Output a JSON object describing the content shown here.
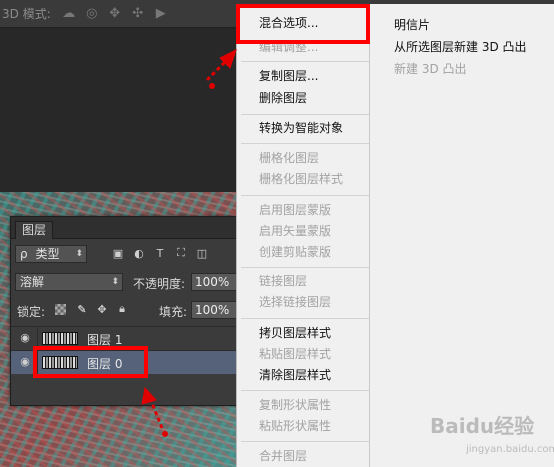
{
  "options_bar": {
    "mode_label": "3D 模式:",
    "icons": [
      "orbit-icon",
      "roll-icon",
      "pan-icon",
      "slide-icon",
      "camera-zoom-icon"
    ]
  },
  "layers_panel": {
    "tab_label": "图层",
    "filter": {
      "search_glyph": "ρ",
      "value": "类型"
    },
    "filter_icons": [
      "image-filter-icon",
      "adjustment-filter-icon",
      "text-filter-icon",
      "shape-filter-icon",
      "smart-object-filter-icon"
    ],
    "blend_mode": "溶解",
    "opacity_label": "不透明度:",
    "opacity_value": "100%",
    "lock_label": "锁定:",
    "fill_label": "填充:",
    "fill_value": "100%",
    "layers": [
      {
        "name": "图层 1",
        "visible": true,
        "selected": false
      },
      {
        "name": "图层 0",
        "visible": true,
        "selected": true
      }
    ]
  },
  "context_menu": {
    "items": [
      {
        "label": "混合选项...",
        "enabled": true
      },
      {
        "label": "编辑调整...",
        "enabled": false
      },
      {
        "label": "复制图层...",
        "enabled": true
      },
      {
        "label": "删除图层",
        "enabled": true
      },
      {
        "label": "转换为智能对象",
        "enabled": true
      },
      {
        "label": "栅格化图层",
        "enabled": false
      },
      {
        "label": "栅格化图层样式",
        "enabled": false
      },
      {
        "label": "启用图层蒙版",
        "enabled": false
      },
      {
        "label": "启用矢量蒙版",
        "enabled": false
      },
      {
        "label": "创建剪贴蒙版",
        "enabled": false
      },
      {
        "label": "链接图层",
        "enabled": false
      },
      {
        "label": "选择链接图层",
        "enabled": false
      },
      {
        "label": "拷贝图层样式",
        "enabled": true
      },
      {
        "label": "粘贴图层样式",
        "enabled": false
      },
      {
        "label": "清除图层样式",
        "enabled": true
      },
      {
        "label": "复制形状属性",
        "enabled": false
      },
      {
        "label": "粘贴形状属性",
        "enabled": false
      },
      {
        "label": "合并图层",
        "enabled": false
      }
    ]
  },
  "submenu": {
    "items": [
      {
        "label": "明信片",
        "enabled": true
      },
      {
        "label": "从所选图层新建 3D 凸出",
        "enabled": true
      },
      {
        "label": "新建 3D 凸出",
        "enabled": false
      }
    ]
  },
  "watermark": {
    "brand": "Baidu经验",
    "url": "jingyan.baidu.com"
  },
  "colors": {
    "highlight": "#ff0000",
    "menu_bg": "#f0f0f0",
    "panel_bg": "#3b3b3b",
    "selected_layer": "#56627a"
  }
}
